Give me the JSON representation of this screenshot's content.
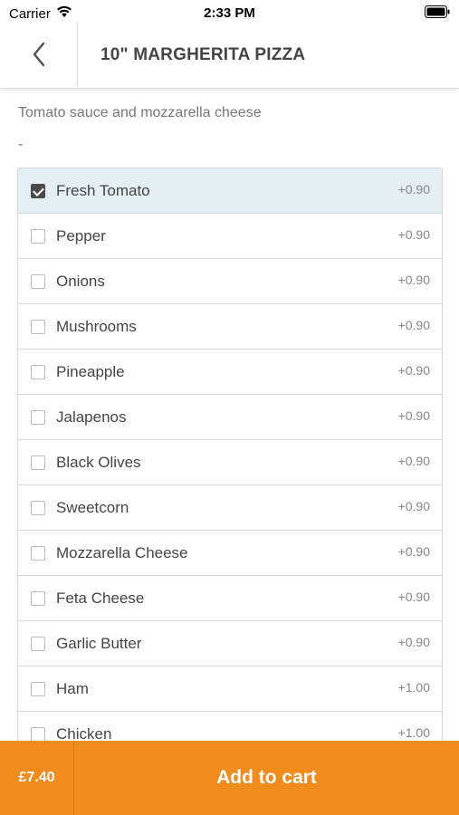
{
  "status_bar": {
    "carrier": "Carrier",
    "time": "2:33 PM",
    "wifi_icon": "wifi-icon",
    "battery_icon": "battery-icon"
  },
  "header": {
    "back_icon": "chevron-left-icon",
    "title": "10\" MARGHERITA PIZZA"
  },
  "product": {
    "description": "Tomato sauce and mozzarella cheese",
    "note": "-"
  },
  "options": [
    {
      "label": "Fresh Tomato",
      "price": "+0.90",
      "checked": true
    },
    {
      "label": "Pepper",
      "price": "+0.90",
      "checked": false
    },
    {
      "label": "Onions",
      "price": "+0.90",
      "checked": false
    },
    {
      "label": "Mushrooms",
      "price": "+0.90",
      "checked": false
    },
    {
      "label": "Pineapple",
      "price": "+0.90",
      "checked": false
    },
    {
      "label": "Jalapenos",
      "price": "+0.90",
      "checked": false
    },
    {
      "label": "Black Olives",
      "price": "+0.90",
      "checked": false
    },
    {
      "label": "Sweetcorn",
      "price": "+0.90",
      "checked": false
    },
    {
      "label": "Mozzarella Cheese",
      "price": "+0.90",
      "checked": false
    },
    {
      "label": "Feta Cheese",
      "price": "+0.90",
      "checked": false
    },
    {
      "label": "Garlic Butter",
      "price": "+0.90",
      "checked": false
    },
    {
      "label": "Ham",
      "price": "+1.00",
      "checked": false
    },
    {
      "label": "Chicken",
      "price": "+1.00",
      "checked": false
    }
  ],
  "cart": {
    "total": "£7.40",
    "add_label": "Add to cart"
  },
  "colors": {
    "accent": "#ef8c1c",
    "selected_row": "#e4eef5"
  }
}
